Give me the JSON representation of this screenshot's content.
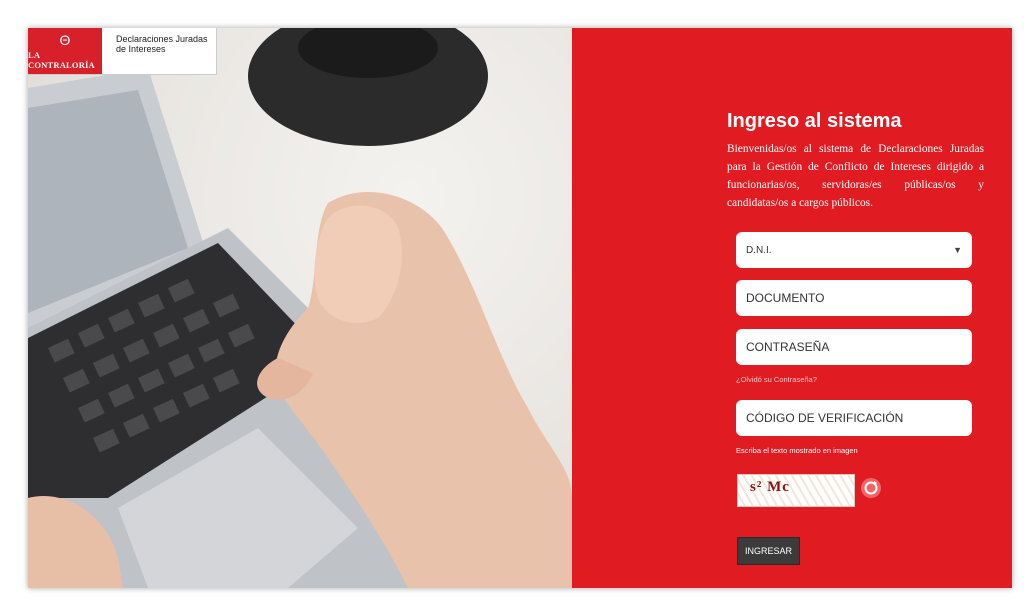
{
  "brand": {
    "logo_name": "LA CONTRALORÍA",
    "logo_mark": "Θ",
    "system_name_line1": "Declaraciones Juradas",
    "system_name_line2": "de Intereses",
    "accent_color": "#e11b22"
  },
  "photo": {
    "description_icon": "laptop-typing-photo-icon"
  },
  "login": {
    "title": "Ingreso al sistema",
    "description": "Bienvenidas/os al sistema de Declaraciones Juradas para la Gestión de Conflicto de Intereses dirigido a funcionarias/os, servidoras/es públicas/os y candidatas/os a cargos públicos.",
    "doc_type_selected": "D.N.I.",
    "document_placeholder": "DOCUMENTO",
    "password_placeholder": "CONTRASEÑA",
    "forgot_password": "¿Olvidó su Contraseña?",
    "verification_placeholder": "CÓDIGO DE VERIFICACIÓN",
    "captcha_hint": "Escriba el texto mostrado en imagen",
    "captcha_text": "s² Mc",
    "refresh_icon": "refresh-icon",
    "submit_label": "INGRESAR"
  }
}
